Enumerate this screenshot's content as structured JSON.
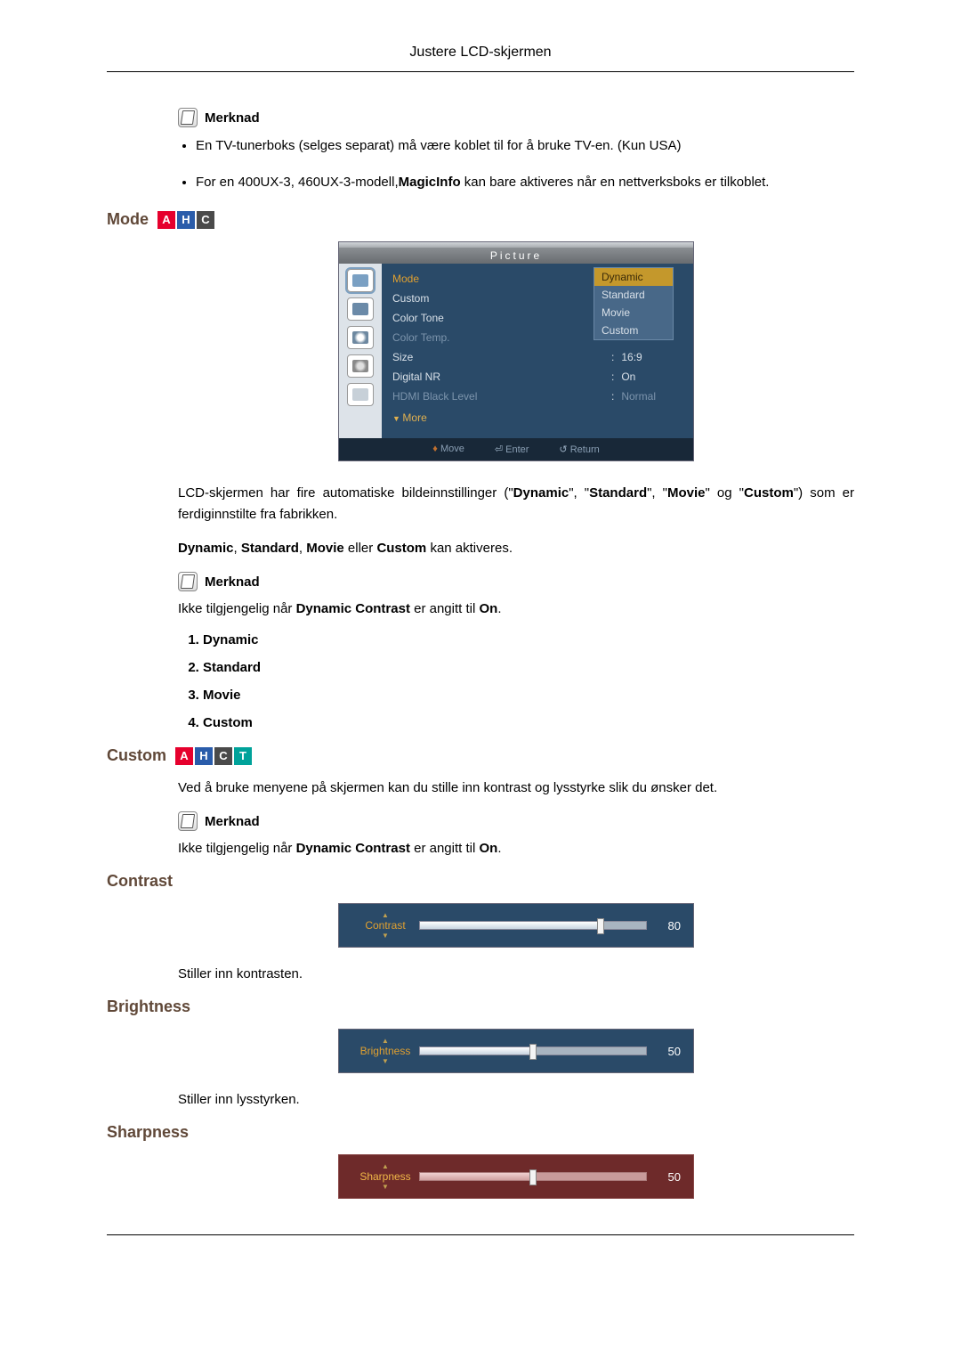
{
  "header": {
    "title": "Justere LCD-skjermen"
  },
  "note1": {
    "label": "Merknad",
    "bullet1": "En TV-tunerboks (selges separat) må være koblet til for å bruke TV-en. (Kun USA)",
    "bullet2_a": "For en 400UX-3, 460UX-3-modell,",
    "bullet2_b": "MagicInfo",
    "bullet2_c": " kan bare aktiveres når en nettverksboks er tilkoblet."
  },
  "mode": {
    "title": "Mode",
    "osd": {
      "title": "Picture",
      "rows": {
        "r1": {
          "label": "Mode"
        },
        "r2": {
          "label": "Custom"
        },
        "r3": {
          "label": "Color Tone"
        },
        "r4": {
          "label": "Color Temp."
        },
        "r5": {
          "label": "Size",
          "value": "16:9"
        },
        "r6": {
          "label": "Digital NR",
          "value": "On"
        },
        "r7": {
          "label": "HDMI Black Level",
          "value": "Normal"
        }
      },
      "popup": {
        "p1": "Dynamic",
        "p2": "Standard",
        "p3": "Movie",
        "p4": "Custom"
      },
      "more": "More",
      "foot": {
        "f1": "Move",
        "f2": "Enter",
        "f3": "Return"
      }
    },
    "desc_a": "LCD-skjermen har fire automatiske bildeinnstillinger (\"",
    "desc_b": "Dynamic",
    "desc_c": "\", \"",
    "desc_d": "Standard",
    "desc_e": "\", \"",
    "desc_f": "Movie",
    "desc_g": "\" og \"",
    "desc_h": "Custom",
    "desc_i": "\") som er ferdiginnstilte fra fabrikken.",
    "line2_a": "Dynamic",
    "line2_b": ", ",
    "line2_c": "Standard",
    "line2_d": ", ",
    "line2_e": "Movie",
    "line2_f": " eller ",
    "line2_g": "Custom",
    "line2_h": " kan aktiveres.",
    "note_label": "Merknad",
    "note_text_a": "Ikke tilgjengelig når ",
    "note_text_b": "Dynamic Contrast",
    "note_text_c": " er angitt til ",
    "note_text_d": "On",
    "note_text_e": ".",
    "list": {
      "l1": "Dynamic",
      "l2": "Standard",
      "l3": "Movie",
      "l4": "Custom"
    }
  },
  "custom": {
    "title": "Custom",
    "desc": "Ved å bruke menyene på skjermen kan du stille inn kontrast og lysstyrke slik du ønsker det.",
    "note_label": "Merknad",
    "note_text_a": "Ikke tilgjengelig når ",
    "note_text_b": "Dynamic Contrast",
    "note_text_c": " er angitt til ",
    "note_text_d": "On",
    "note_text_e": "."
  },
  "contrast": {
    "title": "Contrast",
    "slider_label": "Contrast",
    "slider_value": "80",
    "desc": "Stiller inn kontrasten."
  },
  "brightness": {
    "title": "Brightness",
    "slider_label": "Brightness",
    "slider_value": "50",
    "desc": "Stiller inn lysstyrken."
  },
  "sharpness": {
    "title": "Sharpness",
    "slider_label": "Sharpness",
    "slider_value": "50"
  }
}
